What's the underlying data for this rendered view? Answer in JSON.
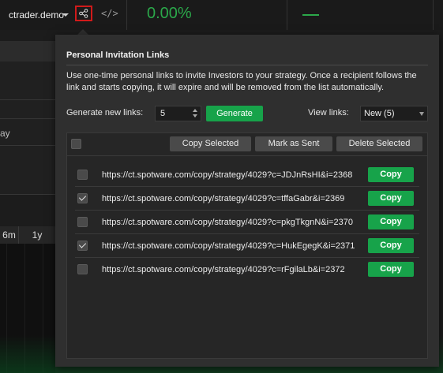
{
  "topbar": {
    "account": "ctrader.demo",
    "percent": "0.00%",
    "code_icon": "</>",
    "accent_color": "#2ba84a"
  },
  "background": {
    "partial_text": "ay",
    "timeframes": [
      "6m",
      "1y"
    ]
  },
  "popup": {
    "title": "Personal Invitation Links",
    "description": "Use one-time personal links to invite Investors to your strategy. Once a recipient follows the link and starts copying, it will expire and will be removed from the list automatically.",
    "generate_label": "Generate new links:",
    "generate_count": "5",
    "generate_button": "Generate",
    "view_label": "View links:",
    "view_selected": "New (5)",
    "actions": {
      "copy_selected": "Copy Selected",
      "mark_as_sent": "Mark as Sent",
      "delete_selected": "Delete Selected"
    },
    "links": [
      {
        "url": "https://ct.spotware.com/copy/strategy/4029?c=JDJnRsHI&i=2368",
        "checked": false,
        "copy_label": "Copy"
      },
      {
        "url": "https://ct.spotware.com/copy/strategy/4029?c=tffaGabr&i=2369",
        "checked": true,
        "copy_label": "Copy"
      },
      {
        "url": "https://ct.spotware.com/copy/strategy/4029?c=pkgTkgnN&i=2370",
        "checked": false,
        "copy_label": "Copy"
      },
      {
        "url": "https://ct.spotware.com/copy/strategy/4029?c=HukEgegK&i=2371",
        "checked": true,
        "copy_label": "Copy"
      },
      {
        "url": "https://ct.spotware.com/copy/strategy/4029?c=rFgilaLb&i=2372",
        "checked": false,
        "copy_label": "Copy"
      }
    ]
  }
}
